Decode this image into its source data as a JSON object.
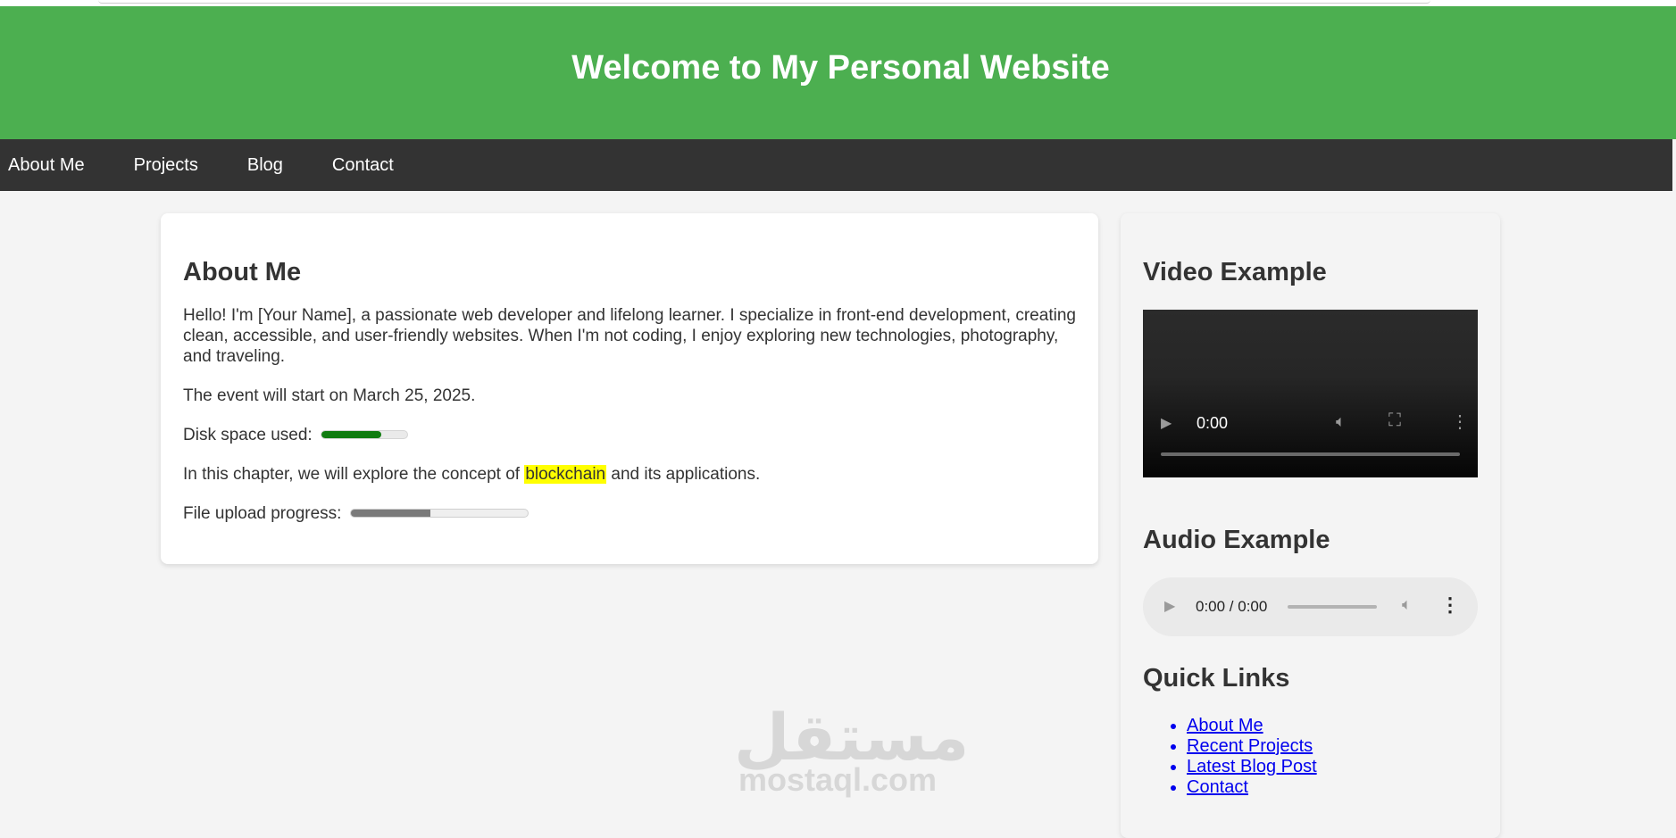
{
  "header": {
    "title": "Welcome to My Personal Website"
  },
  "nav": {
    "items": [
      "About Me",
      "Projects",
      "Blog",
      "Contact"
    ]
  },
  "main": {
    "heading": "About Me",
    "intro": "Hello! I'm [Your Name], a passionate web developer and lifelong learner. I specialize in front-end development, creating clean, accessible, and user-friendly websites. When I'm not coding, I enjoy exploring new technologies, photography, and traveling.",
    "event": "The event will start on March 25, 2025.",
    "disk_label": "Disk space used:",
    "disk_used_fraction": 0.7,
    "chapter_before": "In this chapter, we will explore the concept of ",
    "chapter_highlight": "blockchain",
    "chapter_after": " and its applications.",
    "upload_label": "File upload progress:",
    "upload_fraction": 0.45
  },
  "sidebar": {
    "video_heading": "Video Example",
    "video_time": "0:00",
    "audio_heading": "Audio Example",
    "audio_time": "0:00 / 0:00",
    "links_heading": "Quick Links",
    "links": [
      "About Me",
      "Recent Projects",
      "Latest Blog Post",
      "Contact"
    ]
  },
  "watermark": {
    "arabic": "مستقل",
    "latin": "mostaql.com"
  },
  "colors": {
    "header": "#4caf50",
    "nav": "#333333",
    "highlight": "#ffff00",
    "meter": "#107c10",
    "link": "#0000ee"
  }
}
